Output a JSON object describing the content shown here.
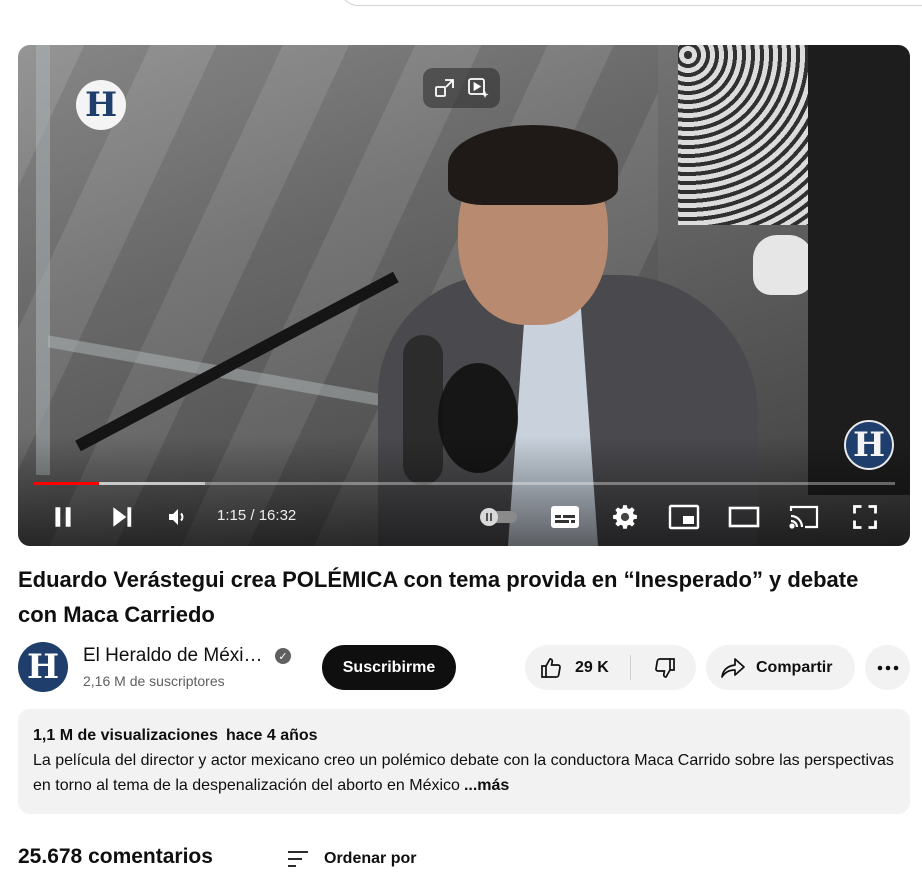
{
  "player": {
    "logo_letter": "H",
    "current_time": "1:15",
    "time_separator": " / ",
    "duration": "16:32",
    "progress_played": 0.076,
    "progress_buffered": 0.2,
    "accent_color": "#ff0000",
    "icons": {
      "top_left": "miniplayer-icon",
      "top_right": "autoplay-preview-icon",
      "play_pause": "pause-icon",
      "next": "skip-next-icon",
      "volume": "volume-icon",
      "autoplay": "autoplay-toggle-icon",
      "subtitles": "subtitles-icon",
      "settings": "gear-icon",
      "miniplayer": "miniplayer-icon",
      "theater": "theater-mode-icon",
      "cast": "cast-icon",
      "fullscreen": "fullscreen-icon"
    }
  },
  "video": {
    "title": "Eduardo Verástegui crea POLÉMICA con tema provida en “Inesperado” y debate con Maca Carriedo"
  },
  "channel": {
    "avatar_letter": "H",
    "name": "El Heraldo de Méxi…",
    "verified_glyph": "✓",
    "subscribers": "2,16 M de suscriptores",
    "subscribe_label": "Suscribirme",
    "brand_color": "#1f3e6b"
  },
  "actions": {
    "like_count": "29 K",
    "share_label": "Compartir"
  },
  "description": {
    "views": "1,1 M de visualizaciones",
    "date": "hace 4 años",
    "text": "La película del director y actor mexicano creo un polémico debate con la conductora Maca Carrido sobre las perspectivas en torno al tema de la despenalización del aborto en México",
    "more_label": "...más"
  },
  "comments": {
    "count_label": "25.678 comentarios",
    "sort_label": "Ordenar por"
  }
}
